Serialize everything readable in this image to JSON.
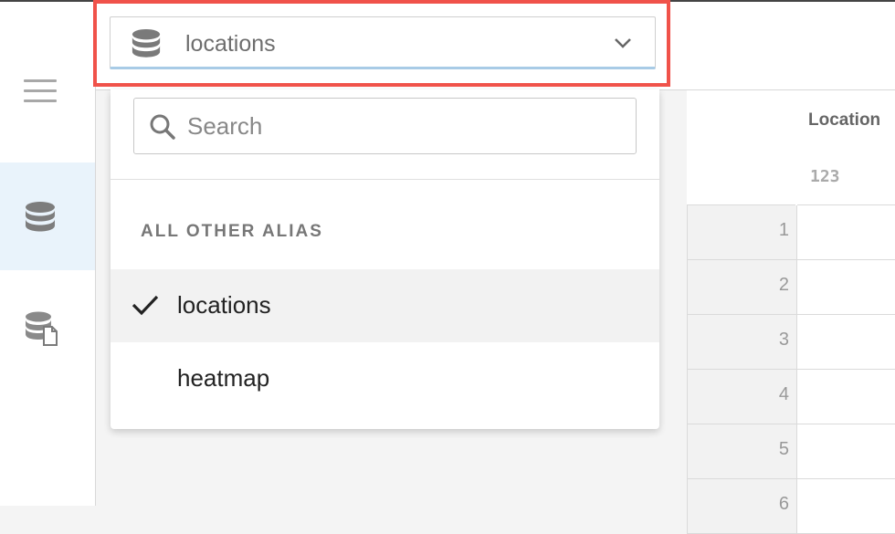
{
  "alias_select": {
    "selected": "locations",
    "search_placeholder": "Search",
    "section_label": "ALL OTHER ALIAS",
    "options": [
      {
        "label": "locations",
        "selected": true
      },
      {
        "label": "heatmap",
        "selected": false
      }
    ]
  },
  "table": {
    "column_title": "Location",
    "column_type": "123",
    "row_numbers": [
      "1",
      "2",
      "3",
      "4",
      "5",
      "6"
    ]
  },
  "colors": {
    "highlight": "#f0524a",
    "active_nav": "#e9f3fb",
    "select_underline": "#a8cbe6"
  },
  "icons": [
    "hamburger-icon",
    "database-icon",
    "database-document-icon",
    "search-icon",
    "chevron-down-icon",
    "check-icon"
  ]
}
